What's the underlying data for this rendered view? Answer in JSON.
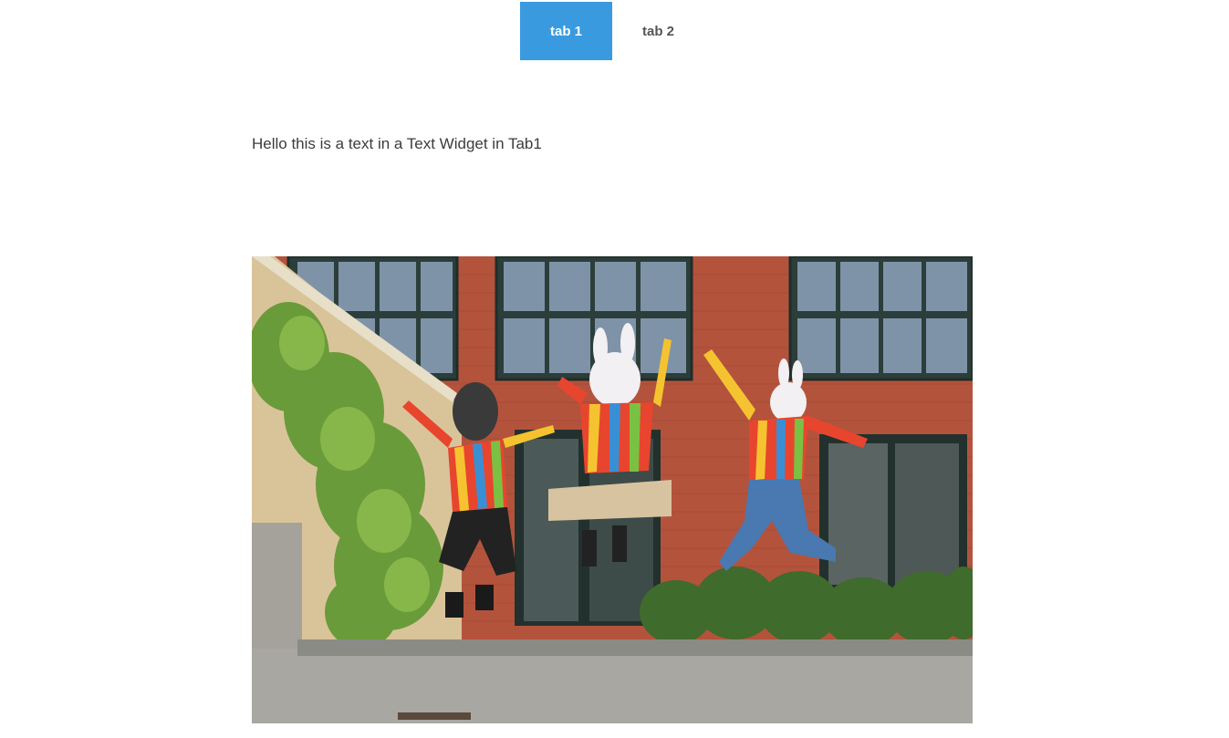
{
  "tabs": [
    {
      "label": "tab 1",
      "active": true
    },
    {
      "label": "tab 2",
      "active": false
    }
  ],
  "content": {
    "text": "Hello this is a text in a Text Widget in Tab1"
  },
  "colors": {
    "accent": "#3a9ae0",
    "text": "#3c3c3c",
    "inactive_tab_text": "#555555"
  },
  "image": {
    "icon": "photo-image"
  }
}
